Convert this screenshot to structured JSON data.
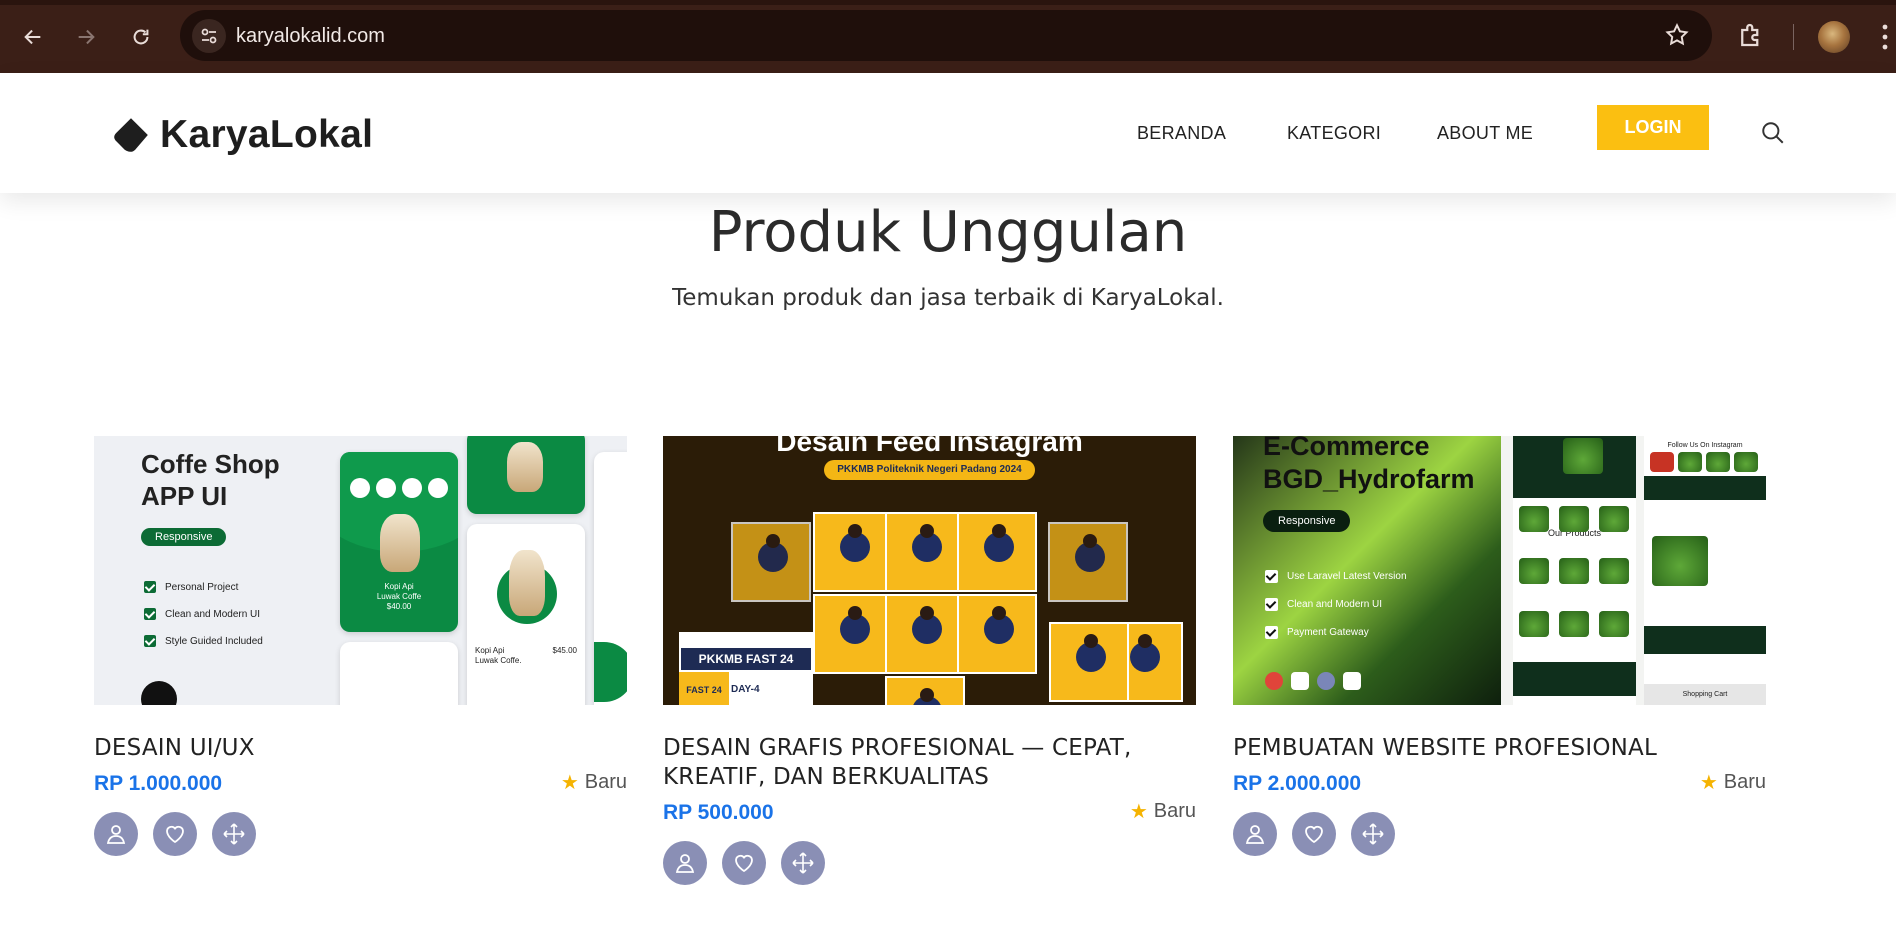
{
  "browser": {
    "url": "karyalokalid.com"
  },
  "site": {
    "brand": "KaryaLokal",
    "menu": [
      "BERANDA",
      "KATEGORI",
      "ABOUT ME"
    ],
    "login_label": "LOGIN"
  },
  "hero": {
    "title": "Produk Unggulan",
    "subtitle": "Temukan produk dan jasa terbaik di KaryaLokal."
  },
  "products": [
    {
      "title": "DESAIN UI/UX",
      "price": "RP 1.000.000",
      "badge": "Baru",
      "thumb": {
        "title_line1": "Coffe Shop",
        "title_line2": "APP UI",
        "tag": "Responsive",
        "features": [
          "Personal Project",
          "Clean and Modern UI",
          "Style Guided Included"
        ],
        "card_name_line1": "Kopi Api",
        "card_name_line2": "Luwak Coffe",
        "card_price": "$40.00",
        "card_name2_line1": "Kopi Api",
        "card_name2_line2": "Luwak Coffe.",
        "card_price2": "$45.00"
      }
    },
    {
      "title": "DESAIN GRAFIS PROFESIONAL — CEPAT, KREATIF, DAN BERKUALITAS",
      "price": "RP 500.000",
      "badge": "Baru",
      "thumb": {
        "heading": "Desain Feed Instagram",
        "tag": "PKKMB Politeknik Negeri Padang 2024",
        "banner": "PKKMB FAST 24",
        "day": "DAY-4",
        "fast": "FAST 24"
      }
    },
    {
      "title": "PEMBUATAN WEBSITE PROFESIONAL",
      "price": "RP 2.000.000",
      "badge": "Baru",
      "thumb": {
        "title_line1": "E-Commerce",
        "title_line2": "BGD_Hydrofarm",
        "tag": "Responsive",
        "features": [
          "Use Laravel Latest Version",
          "Clean and Modern UI",
          "Payment Gateway"
        ],
        "section": "Our Products",
        "follow": "Follow Us On Instagram",
        "cart": "Shopping Cart"
      }
    }
  ],
  "colors": {
    "browser_bg": "#3b1f17",
    "login_bg": "#fbbf11",
    "price": "#1a73e8",
    "action_btn": "#8a8fb5",
    "star": "#f5b301"
  },
  "icons": [
    "back-arrow-icon",
    "forward-arrow-icon",
    "reload-icon",
    "site-settings-icon",
    "bookmark-star-icon",
    "extensions-icon",
    "kebab-menu-icon",
    "logo-mark-icon",
    "search-icon",
    "star-icon",
    "user-icon",
    "heart-icon",
    "move-icon"
  ]
}
